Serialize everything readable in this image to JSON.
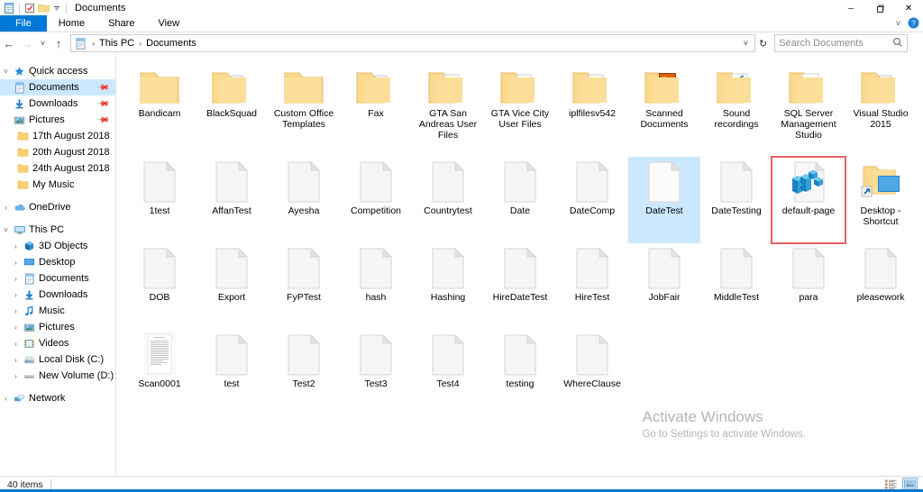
{
  "window": {
    "title": "Documents",
    "quick_access_icons": [
      "properties-icon",
      "checkbox-icon",
      "folder-icon",
      "customize-dropdown-icon"
    ],
    "minimize_label": "–",
    "maximize_label": "❐",
    "close_label": "✕",
    "help_label": "?",
    "collapse_ribbon_label": "˅"
  },
  "ribbon": {
    "tabs": [
      {
        "label": "File",
        "active": true
      },
      {
        "label": "Home",
        "active": false
      },
      {
        "label": "Share",
        "active": false
      },
      {
        "label": "View",
        "active": false
      }
    ]
  },
  "addressbar": {
    "back_label": "←",
    "forward_label": "→",
    "recent_label": "˅",
    "up_label": "↑",
    "breadcrumb_icon": "documents-icon",
    "breadcrumbs": [
      "This PC",
      "Documents"
    ],
    "separator": "›",
    "dropdown_label": "˅",
    "refresh_label": "↻",
    "search_placeholder": "Search Documents",
    "search_value": "",
    "search_icon": "magnifier-icon"
  },
  "sidebar": {
    "groups": [
      {
        "name": "quick-access",
        "expander": "˅",
        "icon": "star-icon",
        "label": "Quick access",
        "items": [
          {
            "label": "Documents",
            "icon": "documents-icon",
            "pinned": true,
            "selected": true,
            "indent": 1
          },
          {
            "label": "Downloads",
            "icon": "downloads-icon",
            "pinned": true,
            "selected": false,
            "indent": 1
          },
          {
            "label": "Pictures",
            "icon": "pictures-icon",
            "pinned": true,
            "selected": false,
            "indent": 1
          },
          {
            "label": "17th August 2018",
            "icon": "folder-icon",
            "pinned": false,
            "selected": false,
            "indent": 1
          },
          {
            "label": "20th August 2018",
            "icon": "folder-icon",
            "pinned": false,
            "selected": false,
            "indent": 1
          },
          {
            "label": "24th August 2018",
            "icon": "folder-icon",
            "pinned": false,
            "selected": false,
            "indent": 1
          },
          {
            "label": "My Music",
            "icon": "folder-icon",
            "pinned": false,
            "selected": false,
            "indent": 1
          }
        ]
      },
      {
        "name": "onedrive",
        "expander": "›",
        "icon": "onedrive-icon",
        "label": "OneDrive",
        "items": []
      },
      {
        "name": "this-pc",
        "expander": "˅",
        "icon": "computer-icon",
        "label": "This PC",
        "items": [
          {
            "label": "3D Objects",
            "icon": "3d-objects-icon",
            "expander": "›",
            "indent": 1
          },
          {
            "label": "Desktop",
            "icon": "desktop-icon",
            "expander": "›",
            "indent": 1
          },
          {
            "label": "Documents",
            "icon": "documents-icon",
            "expander": "›",
            "indent": 1
          },
          {
            "label": "Downloads",
            "icon": "downloads-icon",
            "expander": "›",
            "indent": 1
          },
          {
            "label": "Music",
            "icon": "music-icon",
            "expander": "›",
            "indent": 1
          },
          {
            "label": "Pictures",
            "icon": "pictures-icon",
            "expander": "›",
            "indent": 1
          },
          {
            "label": "Videos",
            "icon": "videos-icon",
            "expander": "›",
            "indent": 1
          },
          {
            "label": "Local Disk (C:)",
            "icon": "drive-icon",
            "expander": "›",
            "indent": 1
          },
          {
            "label": "New Volume (D:)",
            "icon": "drive-icon",
            "expander": "›",
            "indent": 1
          }
        ]
      },
      {
        "name": "network",
        "expander": "›",
        "icon": "network-icon",
        "label": "Network",
        "items": []
      }
    ]
  },
  "files": {
    "rows": [
      [
        {
          "name": "Bandicam",
          "icon": "folder-plain-icon"
        },
        {
          "name": "BlackSquad",
          "icon": "folder-files-icon"
        },
        {
          "name": "Custom Office Templates",
          "icon": "folder-plain-icon"
        },
        {
          "name": "Fax",
          "icon": "folder-files-icon"
        },
        {
          "name": "GTA San Andreas User Files",
          "icon": "folder-doc-icon"
        },
        {
          "name": "GTA Vice City User Files",
          "icon": "folder-doc-icon"
        },
        {
          "name": "iplfilesv542",
          "icon": "folder-doc-icon"
        },
        {
          "name": "Scanned Documents",
          "icon": "folder-photo-icon"
        },
        {
          "name": "Sound recordings",
          "icon": "folder-audio-icon"
        },
        {
          "name": "SQL Server Management Studio",
          "icon": "folder-app-icon"
        },
        {
          "name": "Visual Studio 2015",
          "icon": "folder-files-icon"
        }
      ],
      [
        {
          "name": "1test",
          "icon": "blank-file-icon"
        },
        {
          "name": "AffanTest",
          "icon": "blank-file-icon"
        },
        {
          "name": "Ayesha",
          "icon": "blank-file-icon"
        },
        {
          "name": "Competition",
          "icon": "blank-file-icon"
        },
        {
          "name": "Countrytest",
          "icon": "blank-file-icon"
        },
        {
          "name": "Date",
          "icon": "blank-file-icon"
        },
        {
          "name": "DateComp",
          "icon": "blank-file-icon"
        },
        {
          "name": "DateTest",
          "icon": "blank-file-icon",
          "selected": true
        },
        {
          "name": "DateTesting",
          "icon": "blank-file-icon"
        },
        {
          "name": "default-page",
          "icon": "cubes-file-icon",
          "highlighted": true
        },
        {
          "name": "Desktop - Shortcut",
          "icon": "desktop-shortcut-icon"
        }
      ],
      [
        {
          "name": "DOB",
          "icon": "blank-file-icon"
        },
        {
          "name": "Export",
          "icon": "blank-file-icon"
        },
        {
          "name": "FyPTest",
          "icon": "blank-file-icon"
        },
        {
          "name": "hash",
          "icon": "blank-file-icon"
        },
        {
          "name": "Hashing",
          "icon": "blank-file-icon"
        },
        {
          "name": "HireDateTest",
          "icon": "blank-file-icon"
        },
        {
          "name": "HireTest",
          "icon": "blank-file-icon"
        },
        {
          "name": "JobFair",
          "icon": "blank-file-icon"
        },
        {
          "name": "MiddleTest",
          "icon": "blank-file-icon"
        },
        {
          "name": "para",
          "icon": "blank-file-icon"
        },
        {
          "name": "pleasework",
          "icon": "blank-file-icon"
        }
      ],
      [
        {
          "name": "Scan0001",
          "icon": "scanned-doc-icon"
        },
        {
          "name": "test",
          "icon": "blank-file-icon"
        },
        {
          "name": "Test2",
          "icon": "blank-file-icon"
        },
        {
          "name": "Test3",
          "icon": "blank-file-icon"
        },
        {
          "name": "Test4",
          "icon": "blank-file-icon"
        },
        {
          "name": "testing",
          "icon": "blank-file-icon"
        },
        {
          "name": "WhereClause",
          "icon": "blank-file-icon"
        }
      ]
    ]
  },
  "watermark": {
    "line1": "Activate Windows",
    "line2": "Go to Settings to activate Windows."
  },
  "statusbar": {
    "item_count": "40 items",
    "view_buttons": [
      {
        "name": "details-view",
        "active": false
      },
      {
        "name": "large-icons-view",
        "active": true
      }
    ]
  },
  "colors": {
    "accent": "#0078d7",
    "selection": "#cce8ff",
    "highlight_box": "#e8606a",
    "folder": "#fcd98b",
    "bottom_bar": "#0b78d0"
  }
}
